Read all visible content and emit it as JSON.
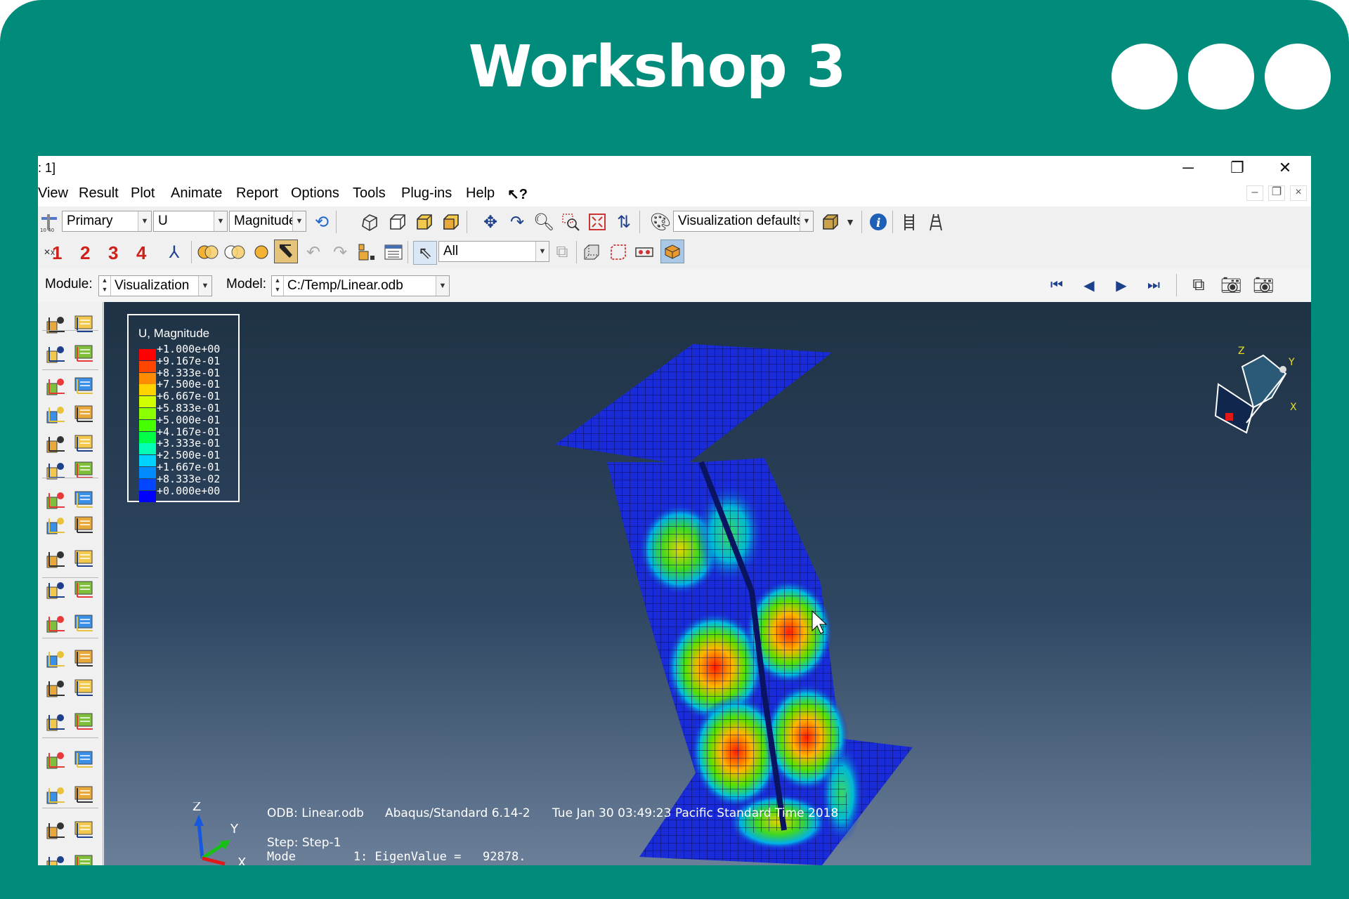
{
  "slide": {
    "title": "Workshop 3"
  },
  "window": {
    "title": ": 1]",
    "minimize": "─",
    "restore": "❐",
    "close": "✕"
  },
  "menu": [
    "View",
    "Result",
    "Plot",
    "Animate",
    "Report",
    "Options",
    "Tools",
    "Plug-ins",
    "Help"
  ],
  "menu_help_cursor": "↖?",
  "toolbar": {
    "field_primary": "Primary",
    "field_variable": "U",
    "field_component": "Magnitude",
    "vis_defaults": "Visualization defaults",
    "viewport_numbers": [
      "1",
      "2",
      "3",
      "4"
    ],
    "selection_filter": "All"
  },
  "context": {
    "module_label": "Module:",
    "module_value": "Visualization",
    "model_label": "Model:",
    "model_value": "C:/Temp/Linear.odb"
  },
  "legend": {
    "title": "U, Magnitude",
    "values": [
      "+1.000e+00",
      "+9.167e-01",
      "+8.333e-01",
      "+7.500e-01",
      "+6.667e-01",
      "+5.833e-01",
      "+5.000e-01",
      "+4.167e-01",
      "+3.333e-01",
      "+2.500e-01",
      "+1.667e-01",
      "+8.333e-02",
      "+0.000e+00"
    ],
    "colors": [
      "#ff0000",
      "#ff4600",
      "#ff8c00",
      "#ffd200",
      "#d2ff00",
      "#8cff00",
      "#46ff00",
      "#00ff46",
      "#00ffb4",
      "#00d2ff",
      "#008cff",
      "#0046ff",
      "#0000ff"
    ]
  },
  "info": {
    "odb": "ODB: Linear.odb",
    "solver": "Abaqus/Standard 6.14-2",
    "date": "Tue Jan 30 03:49:23 Pacific Standard Time 2018",
    "step": "Step: Step-1",
    "mode": "Mode        1: EigenValue =   92878."
  },
  "triad": {
    "z": "Z",
    "y": "Y",
    "x": "X"
  },
  "colors": {
    "frame": "#008b7a",
    "viewport_top": "#1f3245",
    "viewport_bottom": "#6b7f99",
    "mesh": "#1a2cd8"
  }
}
